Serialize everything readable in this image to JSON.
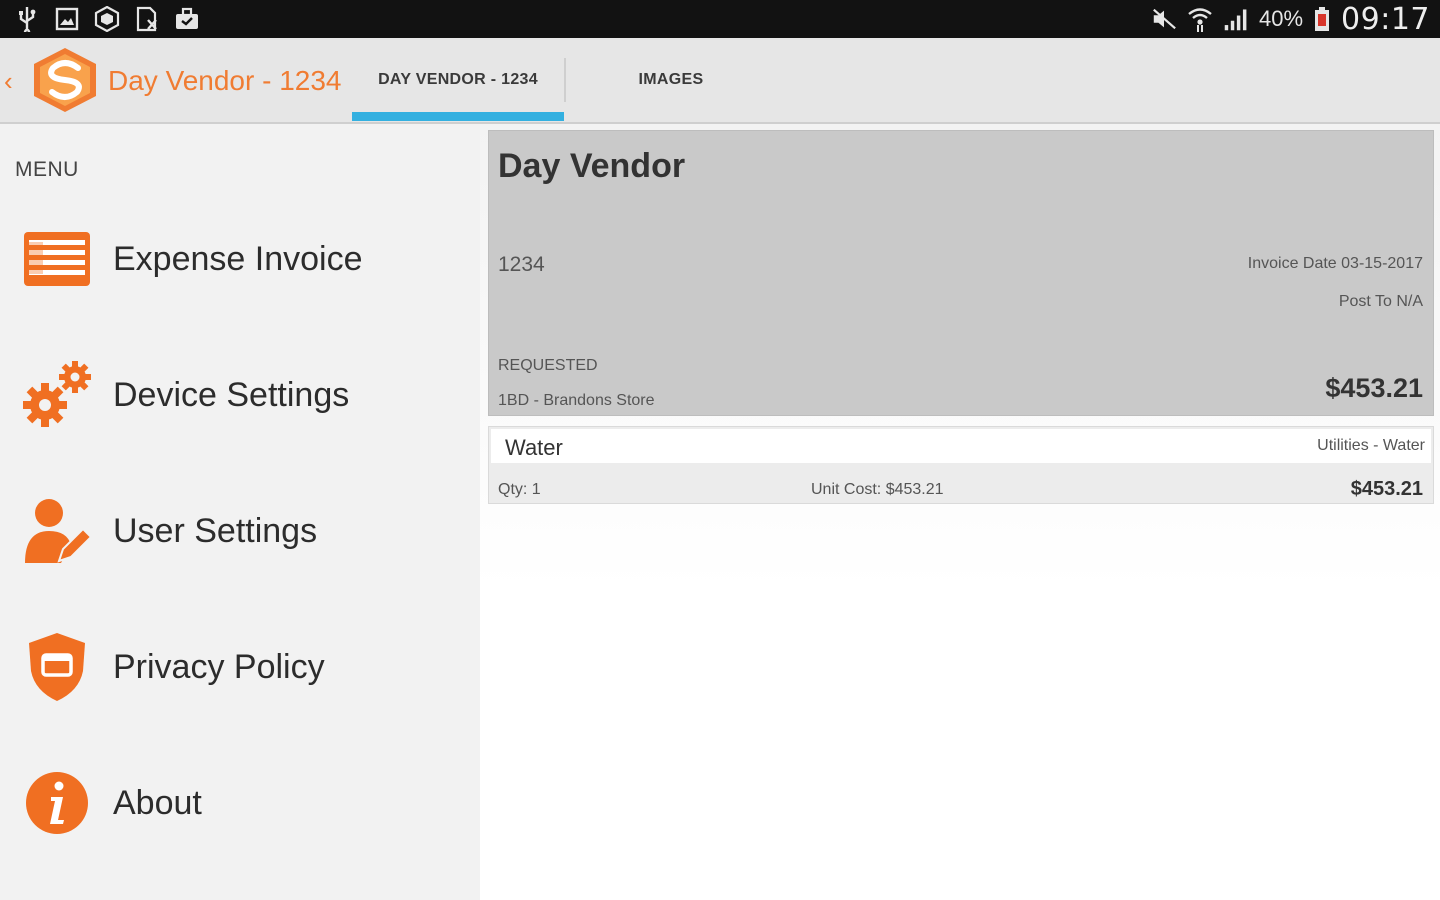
{
  "status_bar": {
    "left_icons": [
      "usb-icon",
      "screenshot-icon",
      "sync-icon",
      "document-icon",
      "briefcase-icon"
    ],
    "battery_percent": "40%",
    "time": "09:17"
  },
  "header": {
    "app_title": "Day Vendor - 1234",
    "tabs": [
      {
        "label": "DAY VENDOR - 1234",
        "selected": true
      },
      {
        "label": "IMAGES",
        "selected": false
      }
    ]
  },
  "sidebar": {
    "menu_label": "MENU",
    "items": [
      {
        "label": "Expense Invoice",
        "icon": "expense-invoice-icon"
      },
      {
        "label": "Device Settings",
        "icon": "gears-icon"
      },
      {
        "label": "User Settings",
        "icon": "user-edit-icon"
      },
      {
        "label": "Privacy Policy",
        "icon": "shield-icon"
      },
      {
        "label": "About",
        "icon": "info-icon"
      }
    ]
  },
  "invoice": {
    "vendor": "Day Vendor",
    "number": "1234",
    "invoice_date": "Invoice Date 03-15-2017",
    "post_to": "Post To N/A",
    "status": "REQUESTED",
    "store": "1BD - Brandons Store",
    "total": "$453.21"
  },
  "line_items": [
    {
      "name": "Water",
      "category": "Utilities - Water",
      "qty": "Qty: 1",
      "unit_cost": "Unit Cost:  $453.21",
      "total": "$453.21"
    }
  ],
  "colors": {
    "accent_orange": "#f07c32",
    "tab_indicator": "#33b0e0",
    "status_bar_bg": "#121212"
  }
}
